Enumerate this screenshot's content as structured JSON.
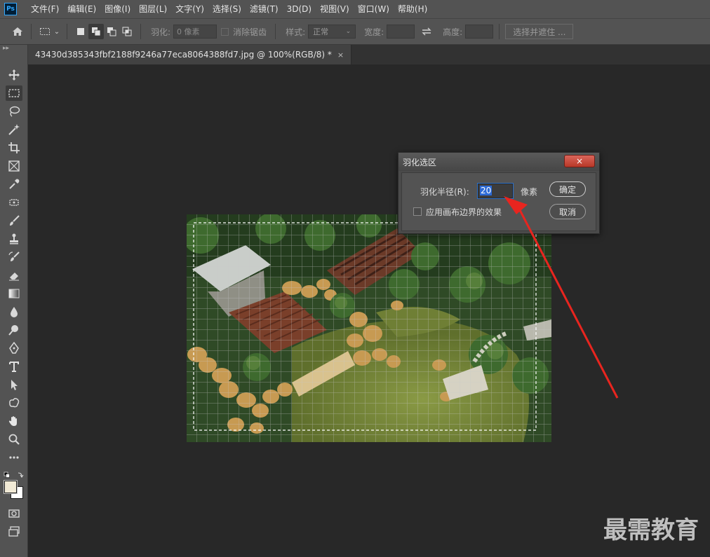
{
  "app": {
    "logo_text": "Ps"
  },
  "menu": {
    "items": [
      "文件(F)",
      "编辑(E)",
      "图像(I)",
      "图层(L)",
      "文字(Y)",
      "选择(S)",
      "滤镜(T)",
      "3D(D)",
      "视图(V)",
      "窗口(W)",
      "帮助(H)"
    ]
  },
  "options": {
    "feather_label": "羽化:",
    "feather_value": "0 像素",
    "antialias_label": "消除锯齿",
    "style_label": "样式:",
    "style_value": "正常",
    "width_label": "宽度:",
    "height_label": "高度:",
    "select_mask_label": "选择并遮住 ..."
  },
  "document": {
    "tab_title": "43430d385343fbf2188f9246a77eca8064388fd7.jpg @ 100%(RGB/8) *",
    "close_glyph": "×"
  },
  "dialog": {
    "title": "羽化选区",
    "close_glyph": "×",
    "radius_label": "羽化半径(R):",
    "radius_value": "20",
    "unit": "像素",
    "apply_canvas_edges_label": "应用画布边界的效果",
    "apply_canvas_edges_checked": false,
    "ok_label": "确定",
    "cancel_label": "取消"
  },
  "watermark": {
    "text": "最需教育"
  },
  "colors": {
    "accent_selection": "#2e6bd6",
    "annotation_red": "#e8251f",
    "foreground_swatch": "#f1ead6",
    "background_swatch": "#ffffff"
  }
}
